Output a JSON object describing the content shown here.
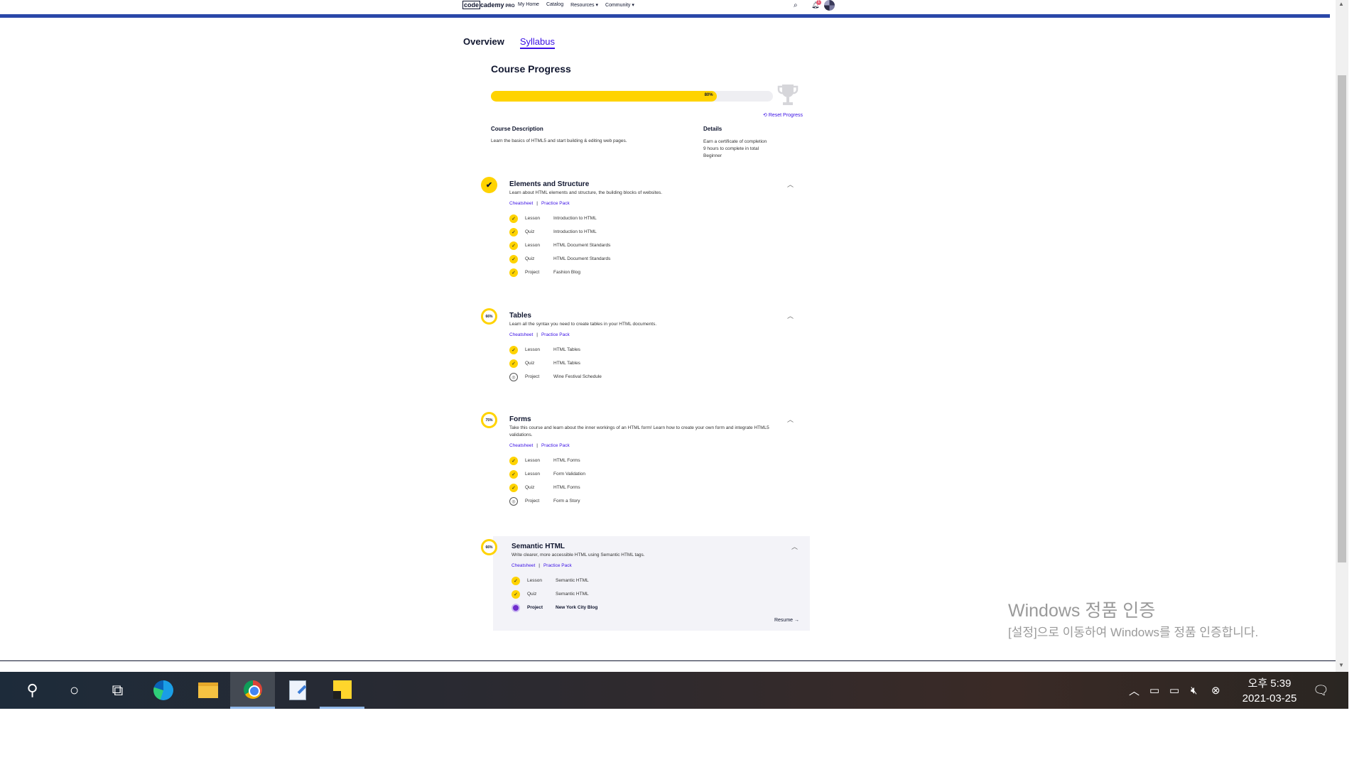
{
  "nav": {
    "logo_code": "code",
    "logo_rest": "cademy",
    "logo_pro": "PRO",
    "links": [
      "My Home",
      "Catalog",
      "Resources ▾",
      "Community ▾"
    ],
    "notification_count": "1",
    "icons": [
      "search-icon",
      "bell-icon",
      "avatar"
    ]
  },
  "tabs": [
    "Overview",
    "Syllabus"
  ],
  "active_tab": "Syllabus",
  "course_progress": {
    "title": "Course Progress",
    "percent_label": "80%",
    "percent": 80,
    "reset_label": "Reset Progress"
  },
  "description": {
    "heading": "Course Description",
    "text": "Learn the basics of HTML5 and start building & editing web pages."
  },
  "details": {
    "heading": "Details",
    "items": [
      "Earn a certificate of completion",
      "9 hours to complete in total",
      "Beginner"
    ]
  },
  "modules": [
    {
      "title": "Elements and Structure",
      "status": "complete",
      "desc": "Learn about HTML elements and structure, the building blocks of websites.",
      "links": [
        "Cheatsheet",
        "Practice Pack"
      ],
      "items": [
        {
          "type": "Lesson",
          "name": "Introduction to HTML",
          "state": "done"
        },
        {
          "type": "Quiz",
          "name": "Introduction to HTML",
          "state": "done"
        },
        {
          "type": "Lesson",
          "name": "HTML Document Standards",
          "state": "done"
        },
        {
          "type": "Quiz",
          "name": "HTML Document Standards",
          "state": "done"
        },
        {
          "type": "Project",
          "name": "Fashion Blog",
          "state": "done"
        }
      ]
    },
    {
      "title": "Tables",
      "status": "66%",
      "desc": "Learn all the syntax you need to create tables in your HTML documents.",
      "links": [
        "Cheatsheet",
        "Practice Pack"
      ],
      "items": [
        {
          "type": "Lesson",
          "name": "HTML Tables",
          "state": "done"
        },
        {
          "type": "Quiz",
          "name": "HTML Tables",
          "state": "done"
        },
        {
          "type": "Project",
          "name": "Wine Festival Schedule",
          "state": "todo"
        }
      ]
    },
    {
      "title": "Forms",
      "status": "75%",
      "desc": "Take this course and learn about the inner workings of an HTML form! Learn how to create your own form and integrate HTML5 validations.",
      "links": [
        "Cheatsheet",
        "Practice Pack"
      ],
      "items": [
        {
          "type": "Lesson",
          "name": "HTML Forms",
          "state": "done"
        },
        {
          "type": "Lesson",
          "name": "Form Validation",
          "state": "done"
        },
        {
          "type": "Quiz",
          "name": "HTML Forms",
          "state": "done"
        },
        {
          "type": "Project",
          "name": "Form a Story",
          "state": "todo"
        }
      ]
    },
    {
      "title": "Semantic HTML",
      "status": "66%",
      "desc": "Write clearer, more accessible HTML using Semantic HTML tags.",
      "links": [
        "Cheatsheet",
        "Practice Pack"
      ],
      "items": [
        {
          "type": "Lesson",
          "name": "Semantic HTML",
          "state": "done"
        },
        {
          "type": "Quiz",
          "name": "Semantic HTML",
          "state": "done"
        },
        {
          "type": "Project",
          "name": "New York City Blog",
          "state": "current"
        }
      ],
      "resume_label": "Resume →"
    }
  ],
  "watermark": {
    "title": "Windows 정품 인증",
    "subtitle": "[설정]으로 이동하여 Windows를 정품 인증합니다."
  },
  "taskbar": {
    "apps": [
      "search-icon",
      "cortana-icon",
      "task-view-icon",
      "edge-icon",
      "file-explorer-icon",
      "chrome-icon",
      "notepad-icon",
      "sticky-notes-icon"
    ],
    "time": "오후 5:39",
    "date": "2021-03-25"
  },
  "colors": {
    "accent": "#3a10e5",
    "progress": "#ffd300",
    "nav_border": "#2a47a8"
  }
}
